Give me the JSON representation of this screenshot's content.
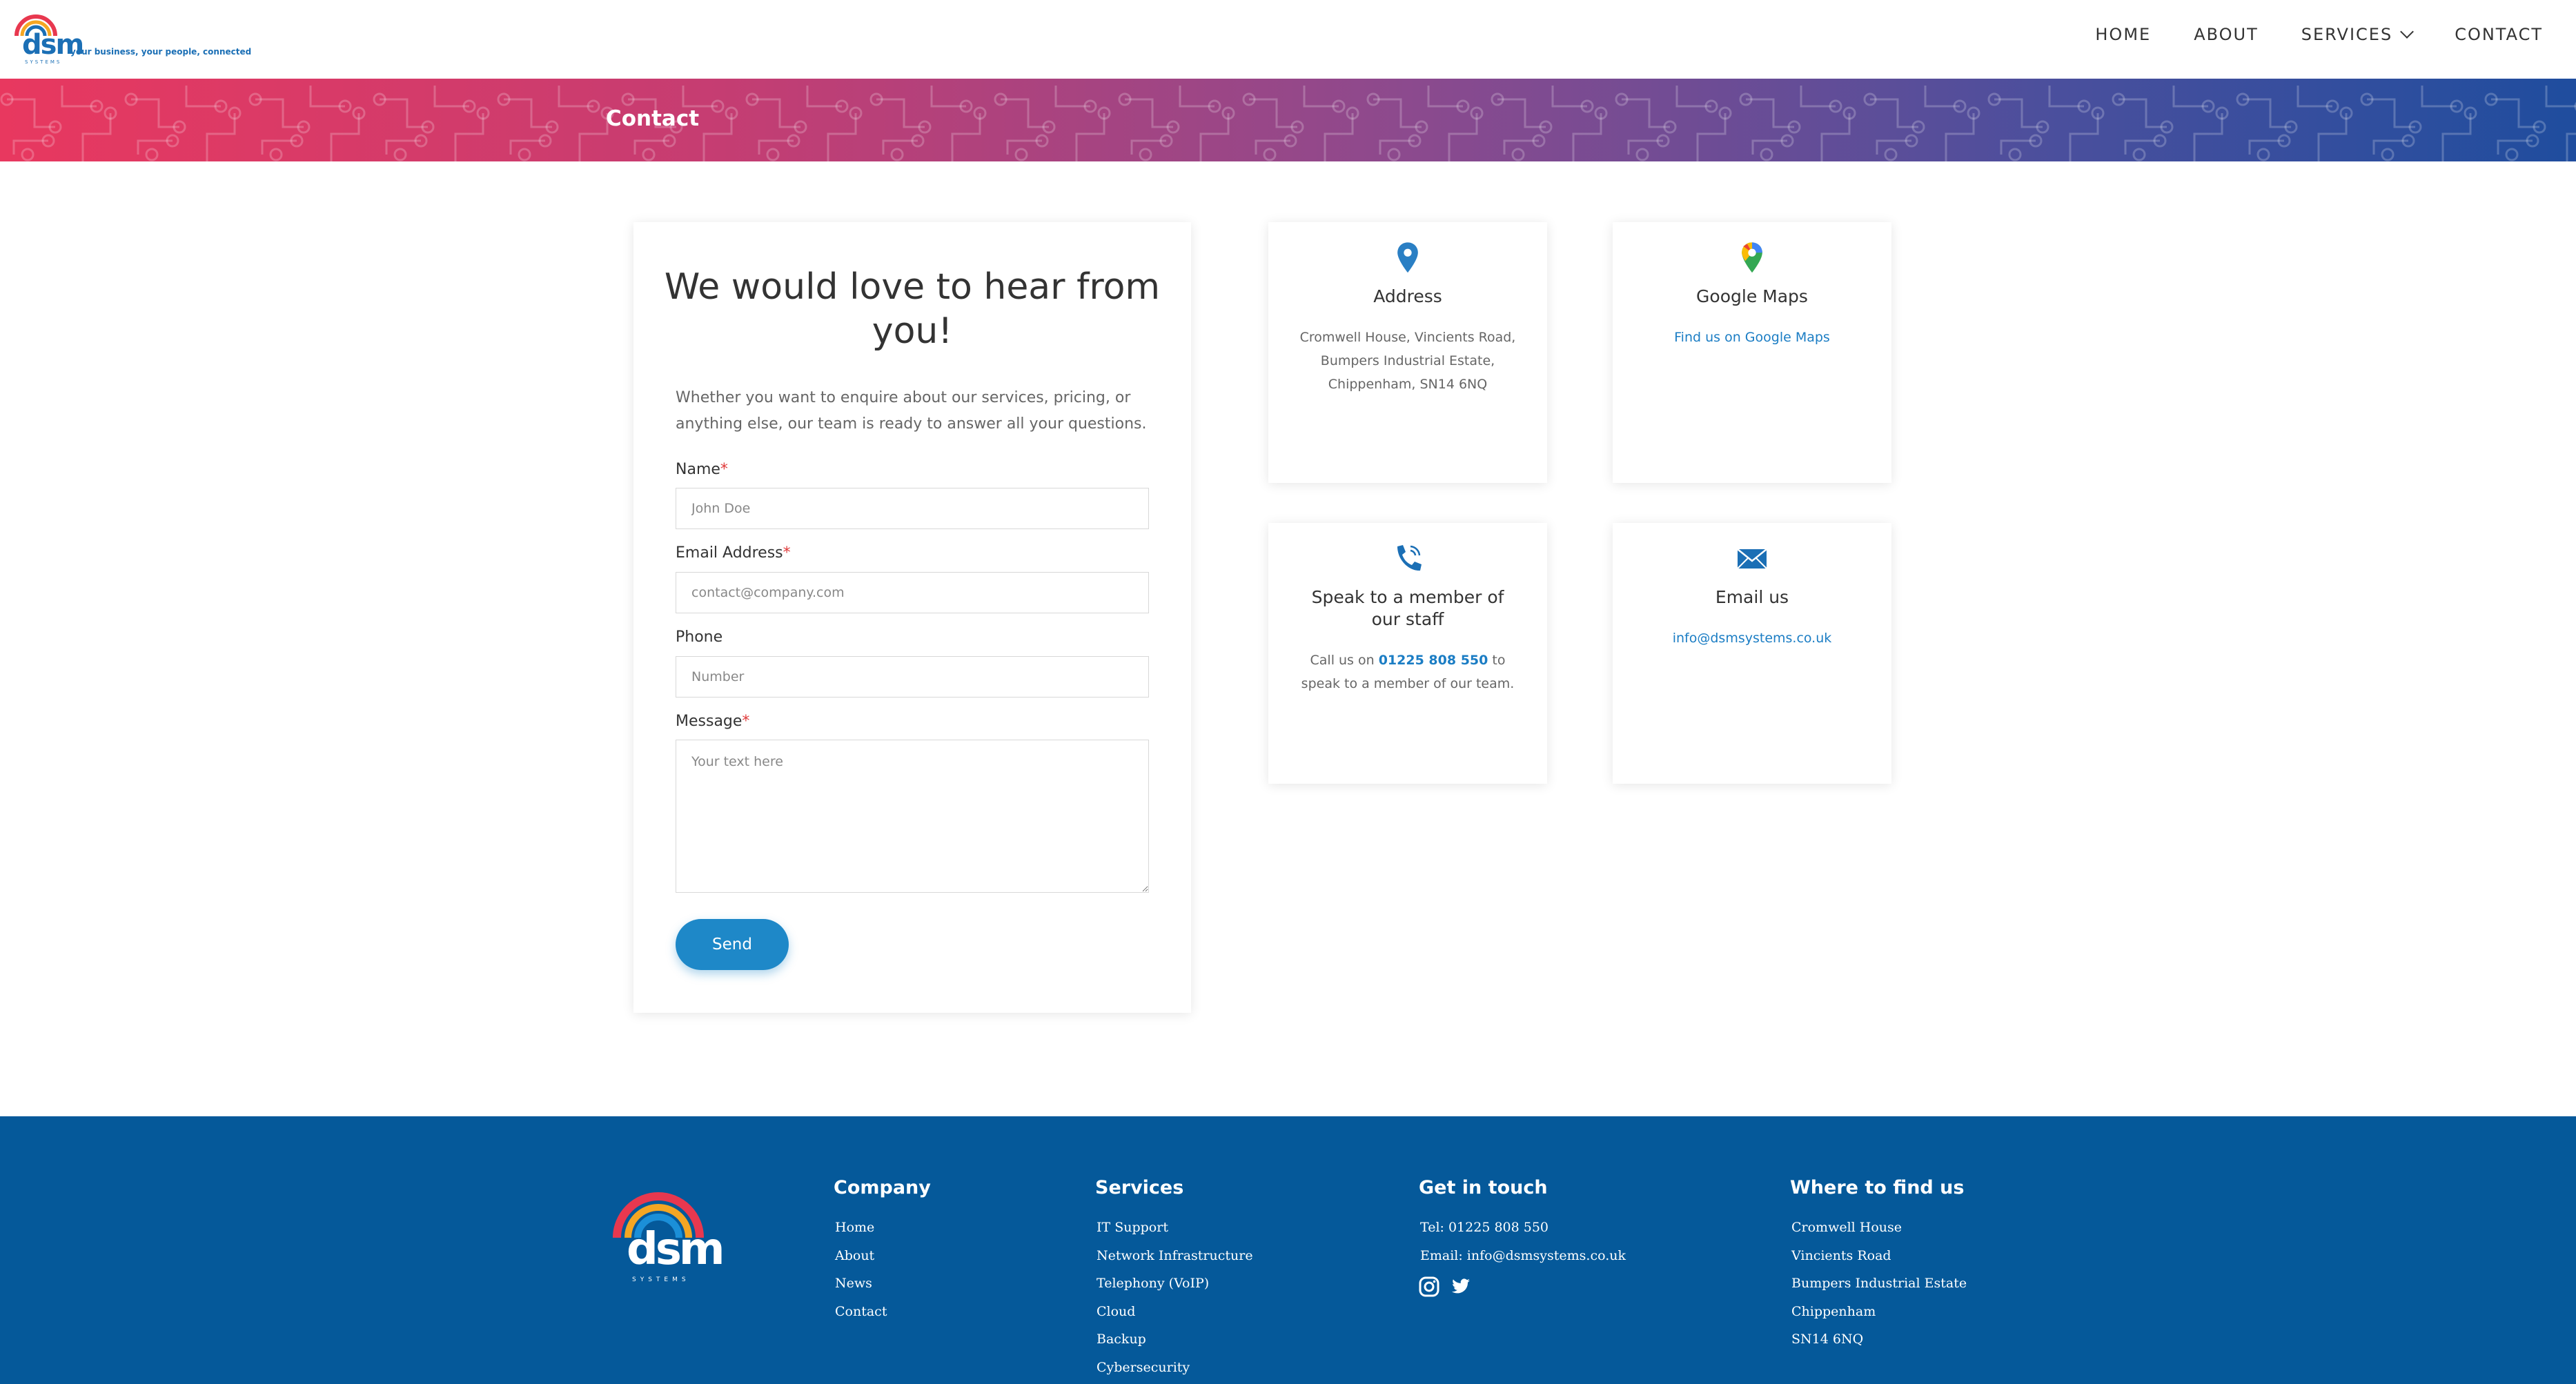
{
  "header": {
    "logo_word": "dsm",
    "logo_tagline": "your business, your people, connected",
    "logo_systems": "SYSTEMS",
    "nav": [
      {
        "label": "HOME"
      },
      {
        "label": "ABOUT"
      },
      {
        "label": "SERVICES"
      },
      {
        "label": "CONTACT"
      }
    ]
  },
  "banner": {
    "title": "Contact"
  },
  "form": {
    "title": "We would love to hear from you!",
    "intro": "Whether you want to enquire about our services, pricing, or anything else, our team is ready to answer all your questions.",
    "name_label": "Name",
    "name_placeholder": "John Doe",
    "email_label": "Email Address",
    "email_placeholder": "contact@company.com",
    "phone_label": "Phone",
    "phone_placeholder": "Number",
    "message_label": "Message",
    "message_placeholder": "Your text here",
    "required_mark": "*",
    "send_label": "Send"
  },
  "cards": {
    "address": {
      "title": "Address",
      "line1": "Cromwell House, Vincients Road,",
      "line2": "Bumpers Industrial Estate,",
      "line3": "Chippenham, SN14 6NQ"
    },
    "maps": {
      "title": "Google Maps",
      "link": "Find us on Google Maps"
    },
    "phone": {
      "title": "Speak to a member of our staff",
      "pre": "Call us on ",
      "number": "01225 808 550",
      "post": " to speak to a member of our team."
    },
    "email": {
      "title": "Email us",
      "link": "info@dsmsystems.co.uk"
    }
  },
  "footer": {
    "logo_word": "dsm",
    "logo_systems": "SYSTEMS",
    "company": {
      "heading": "Company",
      "links": [
        "Home",
        "About",
        "News",
        "Contact"
      ]
    },
    "services": {
      "heading": "Services",
      "links": [
        "IT Support",
        "Network Infrastructure",
        "Telephony (VoIP)",
        "Cloud",
        "Backup",
        "Cybersecurity"
      ]
    },
    "get_in_touch": {
      "heading": "Get in touch",
      "tel": "Tel: 01225 808 550",
      "email": "Email: info@dsmsystems.co.uk"
    },
    "where": {
      "heading": "Where to find us",
      "lines": [
        "Cromwell House",
        "Vincients Road",
        "Bumpers Industrial Estate",
        "Chippenham",
        "SN14 6NQ"
      ]
    }
  },
  "colors": {
    "brand_blue": "#1b7dc4",
    "footer_blue": "#05599a",
    "banner_start": "#e8385f",
    "banner_end": "#1f4d9e",
    "button": "#1e88c8"
  }
}
